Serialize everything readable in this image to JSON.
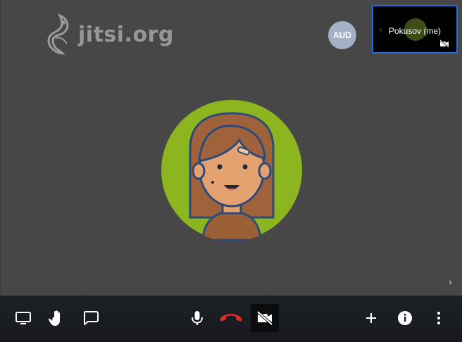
{
  "branding": {
    "logo_text": "jitsi.org"
  },
  "participants": {
    "remote_badge": "AUD",
    "local_thumbnail_name": "Pokusov (me)"
  },
  "colors": {
    "stage_bg": "#474747",
    "toolbar_bg": "#1d2025",
    "thumbnail_border": "#1e6ee0",
    "avatar_bg": "#8cb51f",
    "hangup": "#e02b2b",
    "badge_bg": "#a4b0c6"
  },
  "toolbar": {
    "left_icons": [
      "screen-share-icon",
      "raise-hand-icon",
      "chat-icon"
    ],
    "center_icons": [
      "microphone-icon",
      "hangup-icon",
      "camera-off-icon"
    ],
    "right_icons": [
      "add-participant-icon",
      "info-icon",
      "more-options-icon"
    ]
  }
}
